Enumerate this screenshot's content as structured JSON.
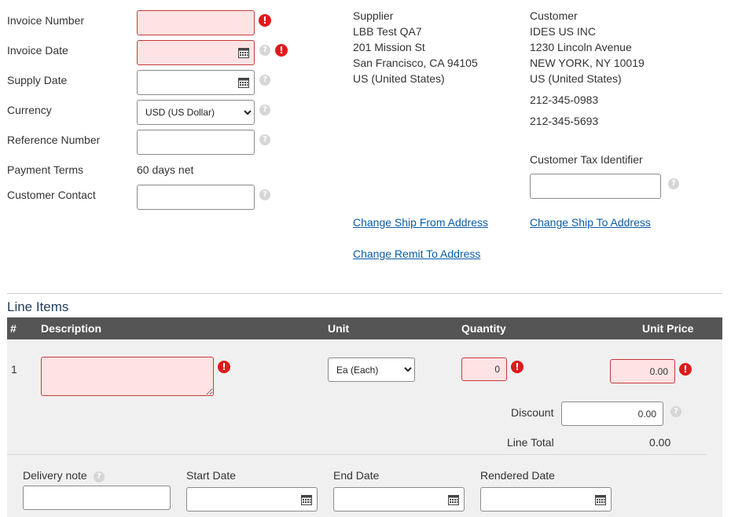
{
  "form": {
    "invoice_number_label": "Invoice Number",
    "invoice_date_label": "Invoice Date",
    "supply_date_label": "Supply Date",
    "currency_label": "Currency",
    "currency_value": "USD (US Dollar)",
    "reference_number_label": "Reference Number",
    "payment_terms_label": "Payment Terms",
    "payment_terms_value": "60 days net",
    "customer_contact_label": "Customer Contact"
  },
  "supplier": {
    "heading": "Supplier",
    "name": "LBB Test QA7",
    "street": "201 Mission St",
    "city": "San Francisco, CA 94105",
    "country": "US (United States)",
    "change_ship_from": "Change Ship From Address",
    "change_remit_to": "Change Remit To Address"
  },
  "customer": {
    "heading": "Customer",
    "name": "IDES US INC",
    "street": "1230 Lincoln Avenue",
    "city": "NEW YORK, NY 10019",
    "country": "US (United States)",
    "phone1": "212-345-0983",
    "phone2": "212-345-5693",
    "tax_identifier_label": "Customer Tax Identifier",
    "change_ship_to": "Change Ship To Address"
  },
  "line_items": {
    "title": "Line Items",
    "columns": {
      "number": "#",
      "description": "Description",
      "unit": "Unit",
      "quantity": "Quantity",
      "unit_price": "Unit Price"
    },
    "row": {
      "number": "1",
      "unit_value": "Ea (Each)",
      "quantity": "0",
      "unit_price": "0.00",
      "discount_label": "Discount",
      "discount_value": "0.00",
      "line_total_label": "Line Total",
      "line_total_value": "0.00"
    },
    "details": {
      "delivery_note_label": "Delivery note",
      "start_date_label": "Start Date",
      "end_date_label": "End Date",
      "rendered_date_label": "Rendered Date"
    }
  },
  "icons": {
    "help": "question-mark",
    "error": "exclamation-circle",
    "calendar": "calendar-grid"
  },
  "colors": {
    "error_bg": "#fde3e3",
    "error_border": "#c53b3b",
    "error_icon": "#e01a1a",
    "link": "#0a5ca8",
    "table_header": "#555555"
  }
}
